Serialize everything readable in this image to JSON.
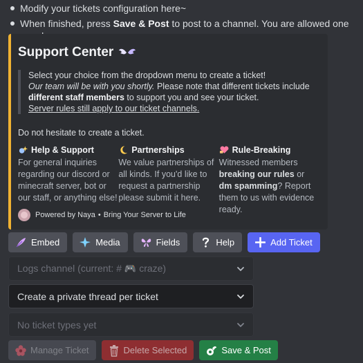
{
  "bullets": [
    {
      "pre": "Modify your tickets configuration here~",
      "bold1": "",
      "mid": "",
      "bold2": "",
      "post": ""
    },
    {
      "pre": "When finished, press ",
      "bold1": "Save & Post",
      "mid": " to post to a channel. You are allowed one panel.",
      "bold2": "",
      "post": ""
    }
  ],
  "embed": {
    "accent": "#f0b232",
    "title": "Support Center",
    "quote": {
      "line1": "Select your choice from the dropdown menu to create a ticket!",
      "italic": "Our team will be with you shortly.",
      "line2_rest": " Please note that different tickets include",
      "bold": "different staff members",
      "line3_rest": " to support you and see your ticket.",
      "underlined": "Server rules still apply to our ticket channels."
    },
    "hesitate": "Do not hesitate to create a ticket.",
    "fields": [
      {
        "icon": "sparkle-hands-icon",
        "name": "Help & Support",
        "v1": "For general inquiries regarding our discord or minecraft server, bot or our staff, or anything else!",
        "b1": "",
        "v2": "",
        "b2": "",
        "v3": ""
      },
      {
        "icon": "crescent-moon-icon",
        "name": "Partnerships",
        "v1": "We value partnerships of all kinds. If you'd like to request a partnership please submit it here.",
        "b1": "",
        "v2": "",
        "b2": "",
        "v3": ""
      },
      {
        "icon": "heart-hands-icon",
        "name": "Rule-Breaking",
        "v1": "Witnessed members ",
        "b1": "breaking our rules",
        "v2": " or ",
        "b2": "dm spamming",
        "v3": "? Report them to us with evidence ready."
      }
    ],
    "footer": {
      "left": "Powered by Naya",
      "separator": "•",
      "right": "Bring Your Server to Life"
    }
  },
  "toolbar": [
    {
      "icon": "feather-icon",
      "label": "Embed"
    },
    {
      "icon": "sparkles-icon",
      "label": "Media"
    },
    {
      "icon": "butterfly-icon",
      "label": "Fields"
    },
    {
      "icon": "question-icon",
      "label": "Help"
    },
    {
      "icon": "plus-icon",
      "label": "Add Ticket"
    }
  ],
  "selects": [
    {
      "text": "Logs channel (current: # 🎮 craze)",
      "disabled": true
    },
    {
      "text": "Create a private thread per ticket",
      "disabled": false
    },
    {
      "text": "No ticket types yet",
      "disabled": true
    }
  ],
  "actions": [
    {
      "icon": "flower-icon",
      "label": "Manage Ticket"
    },
    {
      "icon": "trash-icon",
      "label": "Delete Selected"
    },
    {
      "icon": "save-icon",
      "label": "Save & Post"
    }
  ]
}
